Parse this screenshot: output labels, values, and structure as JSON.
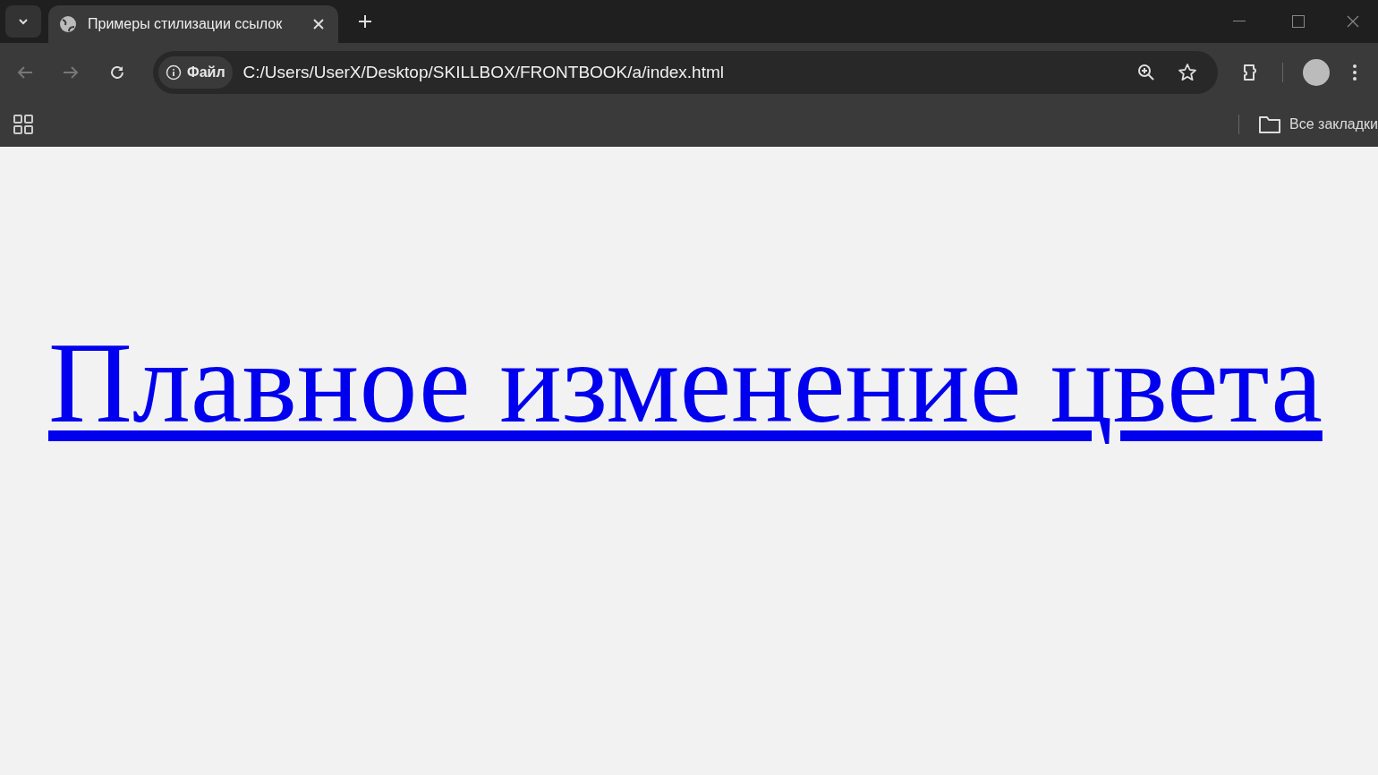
{
  "tabs": [
    {
      "title": "Примеры стилизации ссылок",
      "selected": true
    }
  ],
  "address_bar": {
    "scheme_label": "Файл",
    "url": "C:/Users/UserX/Desktop/SKILLBOX/FRONTBOOK/a/index.html"
  },
  "bookmarks_bar": {
    "all_bookmarks": "Все закладки"
  },
  "page": {
    "link": "Плавное изменение цвета"
  }
}
